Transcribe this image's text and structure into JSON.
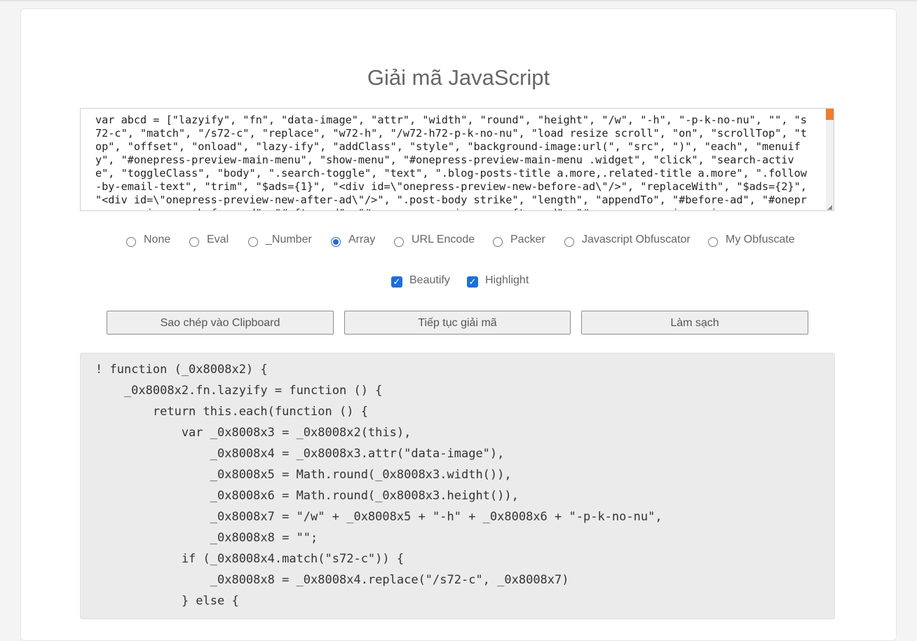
{
  "page": {
    "title": "Giải mã JavaScript"
  },
  "input": {
    "code": "var abcd = [\"lazyify\", \"fn\", \"data-image\", \"attr\", \"width\", \"round\", \"height\", \"/w\", \"-h\", \"-p-k-no-nu\", \"\", \"s72-c\", \"match\", \"/s72-c\", \"replace\", \"w72-h\", \"/w72-h72-p-k-no-nu\", \"load resize scroll\", \"on\", \"scrollTop\", \"top\", \"offset\", \"onload\", \"lazy-ify\", \"addClass\", \"style\", \"background-image:url(\", \"src\", \")\", \"each\", \"menuify\", \"#onepress-preview-main-menu\", \"show-menu\", \"#onepress-preview-main-menu .widget\", \"click\", \"search-active\", \"toggleClass\", \"body\", \".search-toggle\", \"text\", \".blog-posts-title a.more,.related-title a.more\", \".follow-by-email-text\", \"trim\", \"$ads={1}\", \"<div id=\\\"onepress-preview-new-before-ad\\\"/>\", \"replaceWith\", \"$ads={2}\", \"<div id=\\\"onepress-preview-new-after-ad\\\"/>\", \".post-body strike\", \"length\", \"appendTo\", \"#before-ad\", \"#onepress-preview-new-before-ad\", \"#after-ad\", \"#onepress-preview-new-after-ad\", \"#onepress-preview-main"
  },
  "modes": [
    {
      "label": "None",
      "checked": false
    },
    {
      "label": "Eval",
      "checked": false
    },
    {
      "label": "_Number",
      "checked": false
    },
    {
      "label": "Array",
      "checked": true
    },
    {
      "label": "URL Encode",
      "checked": false
    },
    {
      "label": "Packer",
      "checked": false
    },
    {
      "label": "Javascript Obfuscator",
      "checked": false
    },
    {
      "label": "My Obfuscate",
      "checked": false
    }
  ],
  "options": {
    "beautify": {
      "label": "Beautify",
      "checked": true
    },
    "highlight": {
      "label": "Highlight",
      "checked": true
    }
  },
  "buttons": {
    "copy": "Sao chép vào Clipboard",
    "continue": "Tiếp tục giải mã",
    "clear": "Làm sạch"
  },
  "output": {
    "lines": [
      "! function (_0x8008x2) {",
      "    _0x8008x2.fn.lazyify = function () {",
      "        return this.each(function () {",
      "            var _0x8008x3 = _0x8008x2(this),",
      "                _0x8008x4 = _0x8008x3.attr(\"data-image\"),",
      "                _0x8008x5 = Math.round(_0x8008x3.width()),",
      "                _0x8008x6 = Math.round(_0x8008x3.height()),",
      "                _0x8008x7 = \"/w\" + _0x8008x5 + \"-h\" + _0x8008x6 + \"-p-k-no-nu\",",
      "                _0x8008x8 = \"\";",
      "            if (_0x8008x4.match(\"s72-c\")) {",
      "                _0x8008x8 = _0x8008x4.replace(\"/s72-c\", _0x8008x7)",
      "            } else {"
    ]
  },
  "colors": {
    "radio_accent": "#2768d8",
    "checkbox_accent": "#1f6fd8",
    "scroll_thumb": "#ef7d2d"
  }
}
